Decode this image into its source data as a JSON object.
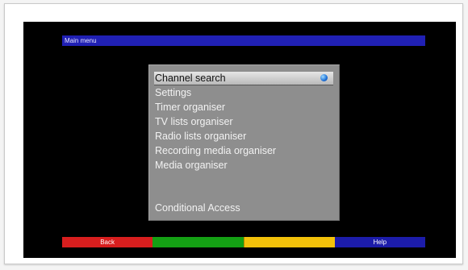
{
  "title": "Main menu",
  "menu": {
    "items": [
      {
        "label": "Channel search",
        "selected": true
      },
      {
        "label": "Settings",
        "selected": false
      },
      {
        "label": "Timer organiser",
        "selected": false
      },
      {
        "label": "TV lists organiser",
        "selected": false
      },
      {
        "label": "Radio lists organiser",
        "selected": false
      },
      {
        "label": "Recording media organiser",
        "selected": false
      },
      {
        "label": "Media organiser",
        "selected": false
      },
      {
        "label": "Conditional Access",
        "selected": false
      }
    ]
  },
  "buttons": {
    "red": {
      "label": "Back",
      "color": "#d81e1e"
    },
    "green": {
      "label": "",
      "color": "#14a014"
    },
    "yellow": {
      "label": "",
      "color": "#f4c20a"
    },
    "blue": {
      "label": "Help",
      "color": "#1c1caa"
    }
  },
  "colors": {
    "title_bar": "#2020b4",
    "menu_panel": "#8e8e8e",
    "screen_background": "#000000"
  }
}
